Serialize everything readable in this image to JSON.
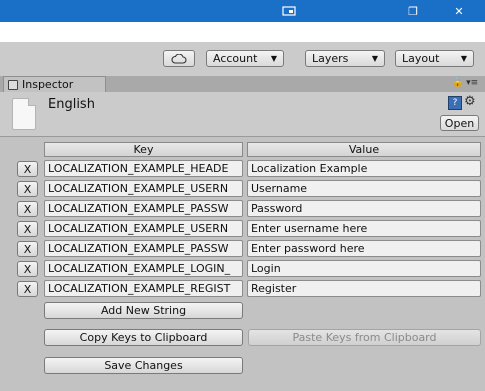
{
  "window": {
    "restore_glyph": "❐",
    "close_glyph": "✕",
    "accent": "#1a6fc6"
  },
  "toolbar": {
    "account_label": "Account",
    "layers_label": "Layers",
    "layout_label": "Layout",
    "dropdown_arrow": "▼"
  },
  "tab": {
    "label": "Inspector",
    "menu_glyph": "🔒 ▾≡"
  },
  "asset": {
    "name": "English",
    "open_label": "Open",
    "help_glyph": "?",
    "settings_glyph": "⚙"
  },
  "table": {
    "key_header": "Key",
    "value_header": "Value",
    "remove_label": "X",
    "rows": [
      {
        "key": "LOCALIZATION_EXAMPLE_HEADE",
        "value": "Localization Example"
      },
      {
        "key": "LOCALIZATION_EXAMPLE_USERN",
        "value": "Username"
      },
      {
        "key": "LOCALIZATION_EXAMPLE_PASSW",
        "value": "Password"
      },
      {
        "key": "LOCALIZATION_EXAMPLE_USERN",
        "value": "Enter username here"
      },
      {
        "key": "LOCALIZATION_EXAMPLE_PASSW",
        "value": "Enter password here"
      },
      {
        "key": "LOCALIZATION_EXAMPLE_LOGIN_",
        "value": "Login"
      },
      {
        "key": "LOCALIZATION_EXAMPLE_REGIST",
        "value": "Register"
      }
    ]
  },
  "actions": {
    "add_label": "Add New String",
    "copy_label": "Copy Keys to Clipboard",
    "paste_label": "Paste Keys from Clipboard",
    "save_label": "Save Changes"
  }
}
